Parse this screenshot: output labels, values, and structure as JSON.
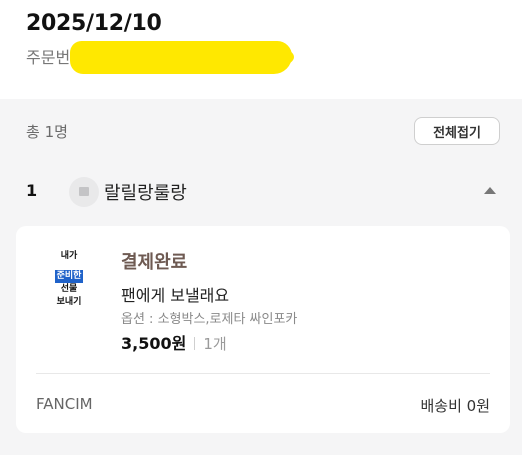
{
  "order": {
    "date": "2025/12/10",
    "number_label": "주문번"
  },
  "summary": {
    "total_count": "총 1명",
    "collapse_all_label": "전체접기"
  },
  "recipient": {
    "index": "1",
    "name": "랄릴랑룰랑",
    "avatar_icon": "image-placeholder-icon",
    "toggle_icon": "chevron-up-icon"
  },
  "item": {
    "thumbnail_text": [
      "내가",
      "준비한",
      "선물",
      "보내기"
    ],
    "status": "결제완료",
    "name": "팬에게 보낼래요",
    "options": "옵션 : 소형박스,로제타 싸인포카",
    "price": "3,500원",
    "quantity": "1개",
    "seller": "FANCIM",
    "shipping_fee": "배송비 0원"
  },
  "colors": {
    "redaction": "#ffe800",
    "status": "#6e5a52",
    "thumbnail_highlight": "#1f62c9",
    "page_background": "#f5f5f6"
  }
}
